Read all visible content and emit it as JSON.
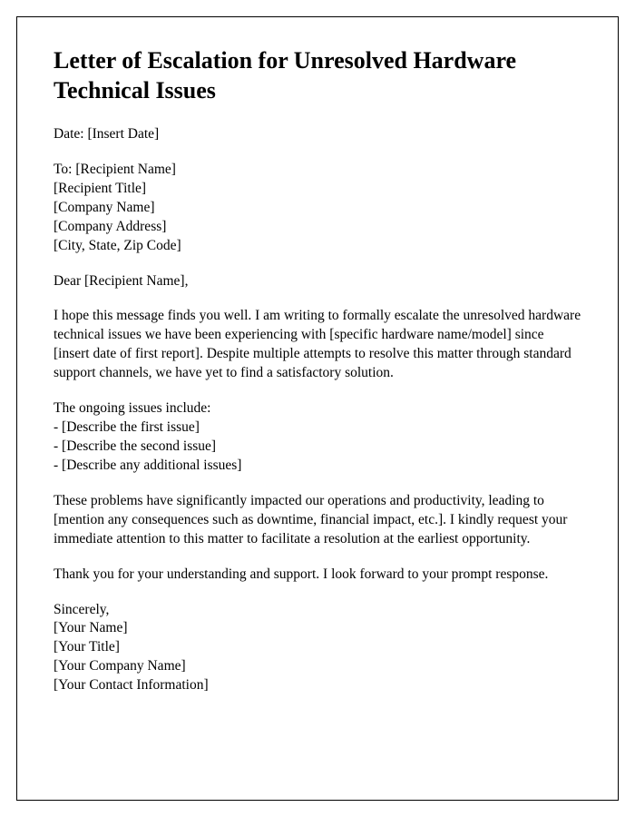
{
  "title": "Letter of Escalation for Unresolved Hardware Technical Issues",
  "date_line": "Date: [Insert Date]",
  "recipient": {
    "to": "To: [Recipient Name]",
    "title": "[Recipient Title]",
    "company": "[Company Name]",
    "address": "[Company Address]",
    "city_state_zip": "[City, State, Zip Code]"
  },
  "salutation": "Dear [Recipient Name],",
  "para1": "I hope this message finds you well. I am writing to formally escalate the unresolved hardware technical issues we have been experiencing with [specific hardware name/model] since [insert date of first report]. Despite multiple attempts to resolve this matter through standard support channels, we have yet to find a satisfactory solution.",
  "issues_intro": "The ongoing issues include:",
  "issues": [
    "- [Describe the first issue]",
    "- [Describe the second issue]",
    "- [Describe any additional issues]"
  ],
  "para2": "These problems have significantly impacted our operations and productivity, leading to [mention any consequences such as downtime, financial impact, etc.]. I kindly request your immediate attention to this matter to facilitate a resolution at the earliest opportunity.",
  "para3": "Thank you for your understanding and support. I look forward to your prompt response.",
  "closing": {
    "sincerely": "Sincerely,",
    "name": "[Your Name]",
    "title": "[Your Title]",
    "company": "[Your Company Name]",
    "contact": "[Your Contact Information]"
  }
}
